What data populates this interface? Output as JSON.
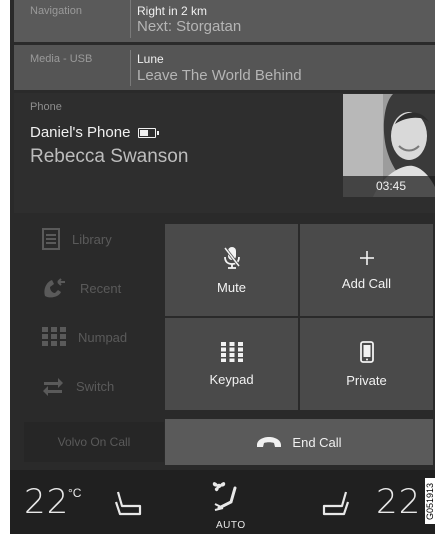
{
  "navigation": {
    "label": "Navigation",
    "line1": "Right in 2 km",
    "line2": "Next: Storgatan"
  },
  "media": {
    "label": "Media - USB",
    "line1": "Lune",
    "line2": "Leave The World Behind"
  },
  "phone": {
    "label": "Phone",
    "device": "Daniel's Phone",
    "caller": "Rebecca Swanson",
    "timer": "03:45",
    "battery_level": 0.5
  },
  "menu": {
    "items": [
      {
        "label": "Library",
        "icon": "library-icon"
      },
      {
        "label": "Recent",
        "icon": "recent-calls-icon"
      },
      {
        "label": "Numpad",
        "icon": "numpad-icon"
      },
      {
        "label": "Switch",
        "icon": "switch-icon"
      }
    ],
    "volvo_on_call": "Volvo On Call"
  },
  "call_controls": {
    "mute": "Mute",
    "add_call": "Add Call",
    "keypad": "Keypad",
    "private": "Private",
    "end_call": "End Call"
  },
  "climate": {
    "left_temp": "22",
    "unit": "°C",
    "right_temp": "22",
    "mode": "AUTO"
  },
  "image_code": "G051913",
  "colors": {
    "background": "#2a2a2a",
    "tile": "#4a4a4a",
    "text": "#f0f0f0"
  }
}
